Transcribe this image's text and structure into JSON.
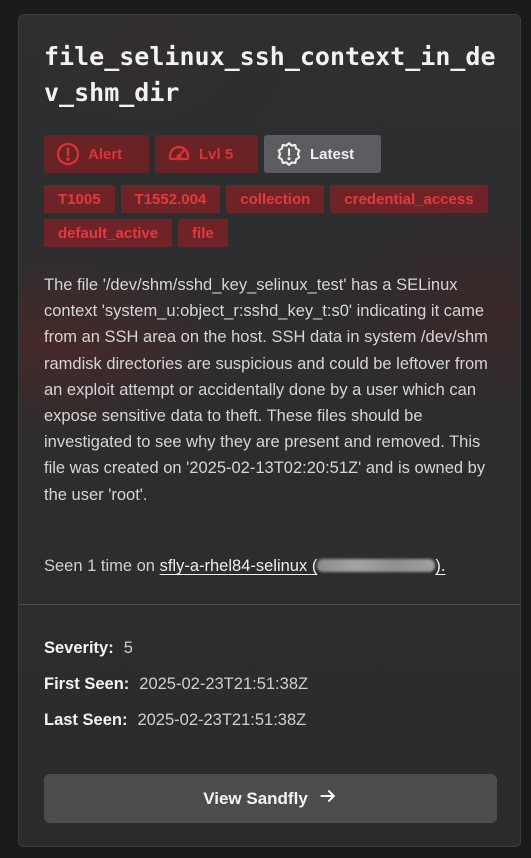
{
  "card": {
    "title": "file_selinux_ssh_context_in_dev_shm_dir",
    "chips": [
      {
        "label": "Alert",
        "icon": "alert-circle-icon"
      },
      {
        "label": "Lvl 5",
        "icon": "gauge-icon"
      },
      {
        "label": "Latest",
        "icon": "badge-alert-icon"
      }
    ],
    "tags": [
      "T1005",
      "T1552.004",
      "collection",
      "credential_access",
      "default_active",
      "file"
    ],
    "description": "The file '/dev/shm/sshd_key_selinux_test' has a SELinux context 'system_u:object_r:sshd_key_t:s0' indicating it came from an SSH area on the host. SSH data in system /dev/shm ramdisk directories are suspicious and could be leftover from an exploit attempt or accidentally done by a user which can expose sensitive data to theft. These files should be investigated to see why they are present and removed. This file was created on '2025-02-13T02:20:51Z' and is owned by the user 'root'.",
    "seen": {
      "prefix": "Seen 1 time on",
      "host": "sfly-a-rhel84-selinux",
      "open_paren": "(",
      "close_paren": ").",
      "redacted_ip_icon": "blurred-text"
    },
    "meta": {
      "severity_label": "Severity:",
      "severity_value": "5",
      "first_seen_label": "First Seen:",
      "first_seen_value": "2025-02-23T21:51:38Z",
      "last_seen_label": "Last Seen:",
      "last_seen_value": "2025-02-23T21:51:38Z"
    },
    "button": {
      "label": "View Sandfly",
      "icon": "arrow-right-icon"
    }
  },
  "colors": {
    "background": "#1a1b1c",
    "card": "#2c2e2f",
    "alert_red": "#e0303a",
    "tag_bg": "#6e2426",
    "latest_bg": "#5b5d60"
  }
}
